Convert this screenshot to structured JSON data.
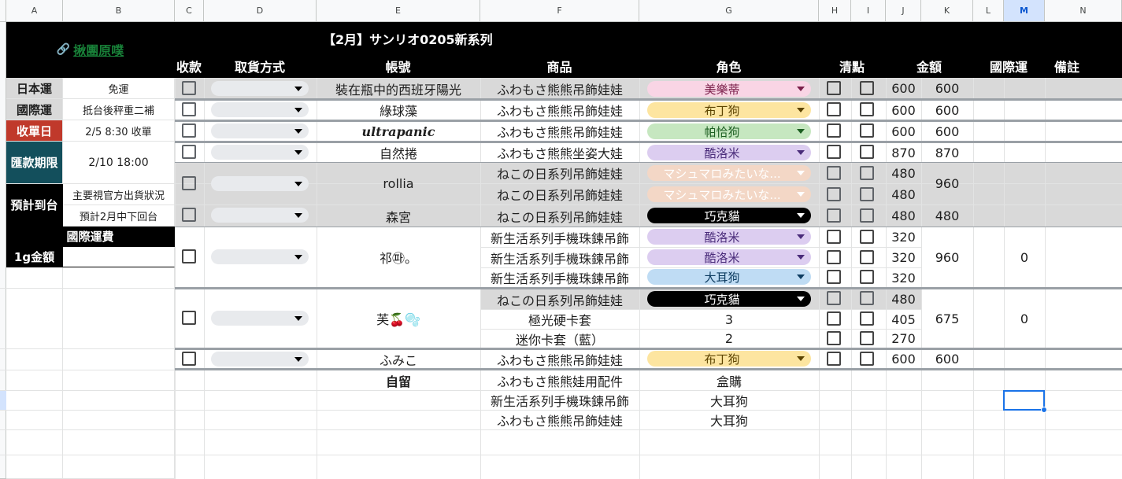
{
  "columns": [
    "A",
    "B",
    "C",
    "D",
    "E",
    "F",
    "G",
    "H",
    "I",
    "J",
    "K",
    "L",
    "M",
    "N"
  ],
  "selected_column": "M",
  "title": "【2月】サンリオ0205新系列",
  "link_label": "揪團原噗",
  "headers": {
    "paid": "收款",
    "pickup": "取貨方式",
    "account": "帳號",
    "product": "商品",
    "character": "角色",
    "check": "清點",
    "amount": "金額",
    "intl_shipping": "國際運",
    "note": "備註"
  },
  "info": {
    "japan_shipping_label": "日本運",
    "japan_shipping_value": "免運",
    "intl_shipping_label": "國際運",
    "intl_shipping_value": "抵台後秤重二補",
    "close_date_label": "收單日",
    "close_date_value": "2/5 8:30 收單",
    "payment_deadline_label": "匯款期限",
    "payment_deadline_value": "2/10 18:00",
    "eta_label": "預計到台",
    "eta_value_1": "主要視官方出貨狀況",
    "eta_value_2": "預計2月中下回台",
    "intl_fee_label": "國際運費",
    "per_gram_label": "1g金額",
    "per_gram_value": ""
  },
  "rows": {
    "r1": {
      "account": "裝在瓶中的西班牙陽光",
      "product": "ふわもさ熊熊吊飾娃娃",
      "character": "美樂蒂",
      "price": "600",
      "total": "600"
    },
    "r2": {
      "account": "綠球藻",
      "product": "ふわもさ熊熊吊飾娃娃",
      "character": "布丁狗",
      "price": "600",
      "total": "600"
    },
    "r3": {
      "account": "ultrapanic",
      "product": "ふわもさ熊熊吊飾娃娃",
      "character": "帕恰狗",
      "price": "600",
      "total": "600"
    },
    "r4": {
      "account": "自然捲",
      "product": "ふわもさ熊熊坐姿大娃",
      "character": "酷洛米",
      "price": "870",
      "total": "870"
    },
    "r5": {
      "account": "rollia",
      "product": "ねこの日系列吊飾娃娃",
      "character": "マシュマロみたいな...",
      "price": "480",
      "total": "960"
    },
    "r6": {
      "product": "ねこの日系列吊飾娃娃",
      "character": "マシュマロみたいな...",
      "price": "480"
    },
    "r7": {
      "account": "森宮",
      "product": "ねこの日系列吊飾娃娃",
      "character": "巧克貓",
      "price": "480",
      "total": "480"
    },
    "r8": {
      "account": "祁㉺。",
      "product": "新生活系列手機珠鍊吊飾",
      "character": "酷洛米",
      "price": "320",
      "total": "960",
      "intl": "0"
    },
    "r9": {
      "product": "新生活系列手機珠鍊吊飾",
      "character": "酷洛米",
      "price": "320"
    },
    "r10": {
      "product": "新生活系列手機珠鍊吊飾",
      "character": "大耳狗",
      "price": "320"
    },
    "r11": {
      "account": "芙🍒🫧",
      "product": "ねこの日系列吊飾娃娃",
      "character": "巧克貓",
      "price": "480",
      "total": "675",
      "intl": "0"
    },
    "r12": {
      "product": "極光硬卡套",
      "qty": "3",
      "price": "405"
    },
    "r13": {
      "product": "迷你卡套（藍）",
      "qty": "2",
      "price": "270"
    },
    "r14": {
      "account": "ふみこ",
      "product": "ふわもさ熊熊吊飾娃娃",
      "character": "布丁狗",
      "price": "600",
      "total": "600"
    },
    "r15": {
      "account": "自留",
      "product": "ふわもさ熊熊娃用配件",
      "qty": "盒購"
    },
    "r16": {
      "product": "新生活系列手機珠鍊吊飾",
      "qty": "大耳狗"
    },
    "r17": {
      "product": "ふわもさ熊熊吊飾娃娃",
      "qty": "大耳狗"
    }
  },
  "chip_colors": {
    "美樂蒂": {
      "bg": "#f9d5e5",
      "fg": "#7b1f4a"
    },
    "布丁狗": {
      "bg": "#fde5a0",
      "fg": "#5c4300"
    },
    "帕恰狗": {
      "bg": "#c6e7c0",
      "fg": "#1b5e20"
    },
    "酷洛米": {
      "bg": "#dccdf0",
      "fg": "#4a2c7a"
    },
    "マシュマロ": {
      "bg": "#f3d7c6",
      "fg": "#ffffff"
    },
    "巧克貓": {
      "bg": "#000000",
      "fg": "#ffffff"
    },
    "大耳狗": {
      "bg": "#bfdcf4",
      "fg": "#0d3c61"
    }
  }
}
